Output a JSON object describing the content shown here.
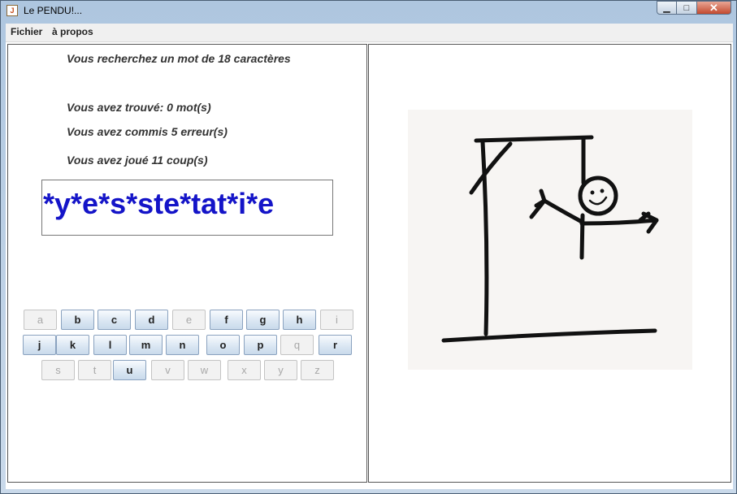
{
  "window": {
    "title": "Le PENDU!...",
    "icon": "java-icon"
  },
  "menu": {
    "file": "Fichier",
    "about": "à propos"
  },
  "info": {
    "search": "Vous recherchez un mot de 18 caractères",
    "found": "Vous avez trouvé: 0 mot(s)",
    "errors": "Vous avez commis 5 erreur(s)",
    "played": "Vous avez joué 11 coup(s)"
  },
  "word": "*y*e*s*ste*tat*i*e",
  "keyboard": {
    "row1": [
      {
        "letter": "a",
        "enabled": false
      },
      {
        "letter": "b",
        "enabled": true
      },
      {
        "letter": "c",
        "enabled": true
      },
      {
        "letter": "d",
        "enabled": true
      },
      {
        "letter": "e",
        "enabled": false
      },
      {
        "letter": "f",
        "enabled": true
      },
      {
        "letter": "g",
        "enabled": true
      },
      {
        "letter": "h",
        "enabled": true
      },
      {
        "letter": "i",
        "enabled": false
      }
    ],
    "row2": [
      {
        "letter": "j",
        "enabled": true
      },
      {
        "letter": "k",
        "enabled": true
      },
      {
        "letter": "l",
        "enabled": true
      },
      {
        "letter": "m",
        "enabled": true
      },
      {
        "letter": "n",
        "enabled": true
      },
      {
        "letter": "o",
        "enabled": true
      },
      {
        "letter": "p",
        "enabled": true
      },
      {
        "letter": "q",
        "enabled": false
      },
      {
        "letter": "r",
        "enabled": true
      }
    ],
    "row3": [
      {
        "letter": "s",
        "enabled": false
      },
      {
        "letter": "t",
        "enabled": false
      },
      {
        "letter": "u",
        "enabled": true
      },
      {
        "letter": "v",
        "enabled": false
      },
      {
        "letter": "w",
        "enabled": false
      },
      {
        "letter": "x",
        "enabled": false
      },
      {
        "letter": "y",
        "enabled": false
      },
      {
        "letter": "z",
        "enabled": false
      }
    ]
  },
  "hangman": {
    "stage": 5,
    "image": "hangman-drawing"
  }
}
